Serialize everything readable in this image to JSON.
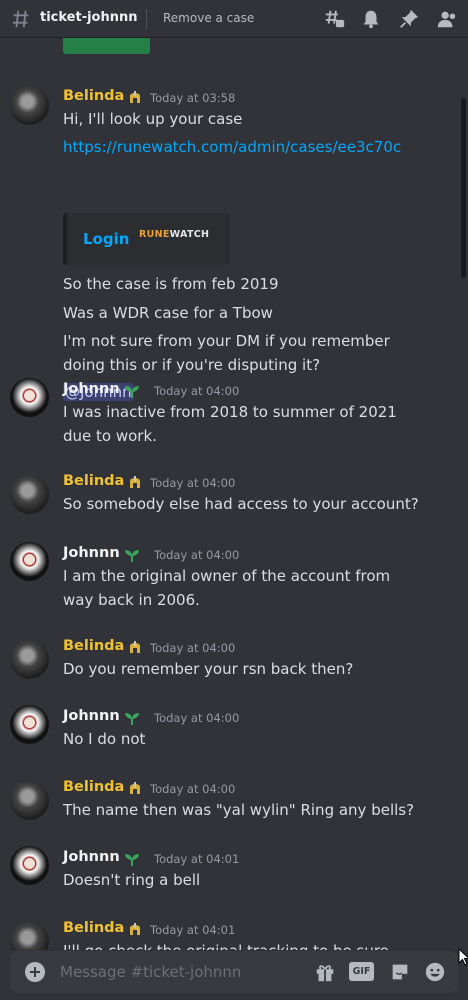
{
  "header": {
    "channel_name": "ticket-johnnn",
    "topic_action": "Remove a case"
  },
  "composer": {
    "placeholder": "Message #ticket-johnnn",
    "gif_label": "GIF"
  },
  "embed": {
    "login_label": "Login",
    "logo_accent": "RUNE",
    "logo_rest": "WATCH"
  },
  "messages": [
    {
      "author": "Belinda",
      "timestamp": "Today at 03:58",
      "lines": [
        "Hi, I'll look up your case",
        "https://runewatch.com/admin/cases/ee3c70c",
        "So the case is from feb 2019",
        "Was a WDR case for a Tbow",
        "I'm not sure from your DM if you remember",
        "doing this or if you're disputing it?",
        "@Johnnn"
      ]
    },
    {
      "author": "Johnnn",
      "timestamp": "Today at 04:00",
      "lines": [
        "I was inactive from 2018 to summer of 2021",
        "due to work."
      ]
    },
    {
      "author": "Belinda",
      "timestamp": "Today at 04:00",
      "lines": [
        "So somebody else had access to your account?"
      ]
    },
    {
      "author": "Johnnn",
      "timestamp": "Today at 04:00",
      "lines": [
        "I am the original owner of the account from",
        "way back in 2006."
      ]
    },
    {
      "author": "Belinda",
      "timestamp": "Today at 04:00",
      "lines": [
        "Do you remember your rsn back then?"
      ]
    },
    {
      "author": "Johnnn",
      "timestamp": "Today at 04:00",
      "lines": [
        "No I do not"
      ]
    },
    {
      "author": "Belinda",
      "timestamp": "Today at 04:00",
      "lines": [
        "The name then was \"yal wylin\" Ring any bells?"
      ]
    },
    {
      "author": "Johnnn",
      "timestamp": "Today at 04:01",
      "lines": [
        "Doesn't ring a bell"
      ]
    },
    {
      "author": "Belinda",
      "timestamp": "Today at 04:01",
      "lines": [
        "I'll go check the original tracking to be sure"
      ]
    }
  ],
  "colors": {
    "background": "#313338",
    "belinda_name": "#f0c232",
    "link": "#00a8fc",
    "mention_bg": "#3c4270"
  },
  "icons": [
    "hash-icon",
    "threads-icon",
    "bell-icon",
    "pin-icon",
    "members-icon",
    "helmet-badge-icon",
    "sprout-badge-icon",
    "add-icon",
    "gift-icon",
    "gif-icon",
    "sticker-icon",
    "emoji-icon"
  ]
}
